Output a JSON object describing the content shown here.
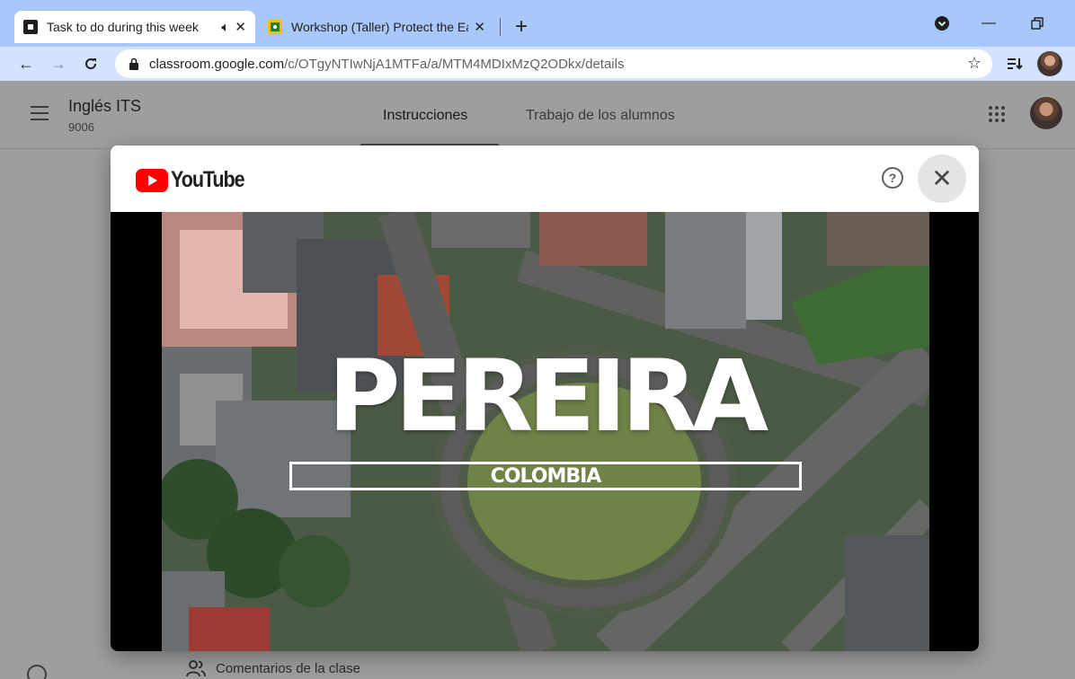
{
  "browser": {
    "tabs": [
      {
        "title": "Task to do during this week",
        "audio_icon": "speaker-icon",
        "close": "✕"
      },
      {
        "title": "Workshop (Taller) Protect the Earth",
        "close": "✕"
      }
    ],
    "new_tab": "+",
    "url_host": "classroom.google.com",
    "url_path": "/c/OTgyNTIwNjA1MTFa/a/MTM4MDIxMzQ2ODkx/details"
  },
  "classroom": {
    "class_name": "Inglés ITS",
    "class_section": "9006",
    "tabs": [
      "Instrucciones",
      "Trabajo de los alumnos"
    ],
    "comments_label": "Comentarios de la clase"
  },
  "youtube_modal": {
    "brand": "YouTube",
    "help_label": "?",
    "close_label": "✕",
    "video_title": "PEREIRA",
    "video_subtitle": "COLOMBIA"
  },
  "colors": {
    "youtube_red": "#ff0000",
    "tab_strip": "#a8c7fa",
    "toolbar": "#d3e3fd",
    "overlay": "#9e9e9e"
  }
}
